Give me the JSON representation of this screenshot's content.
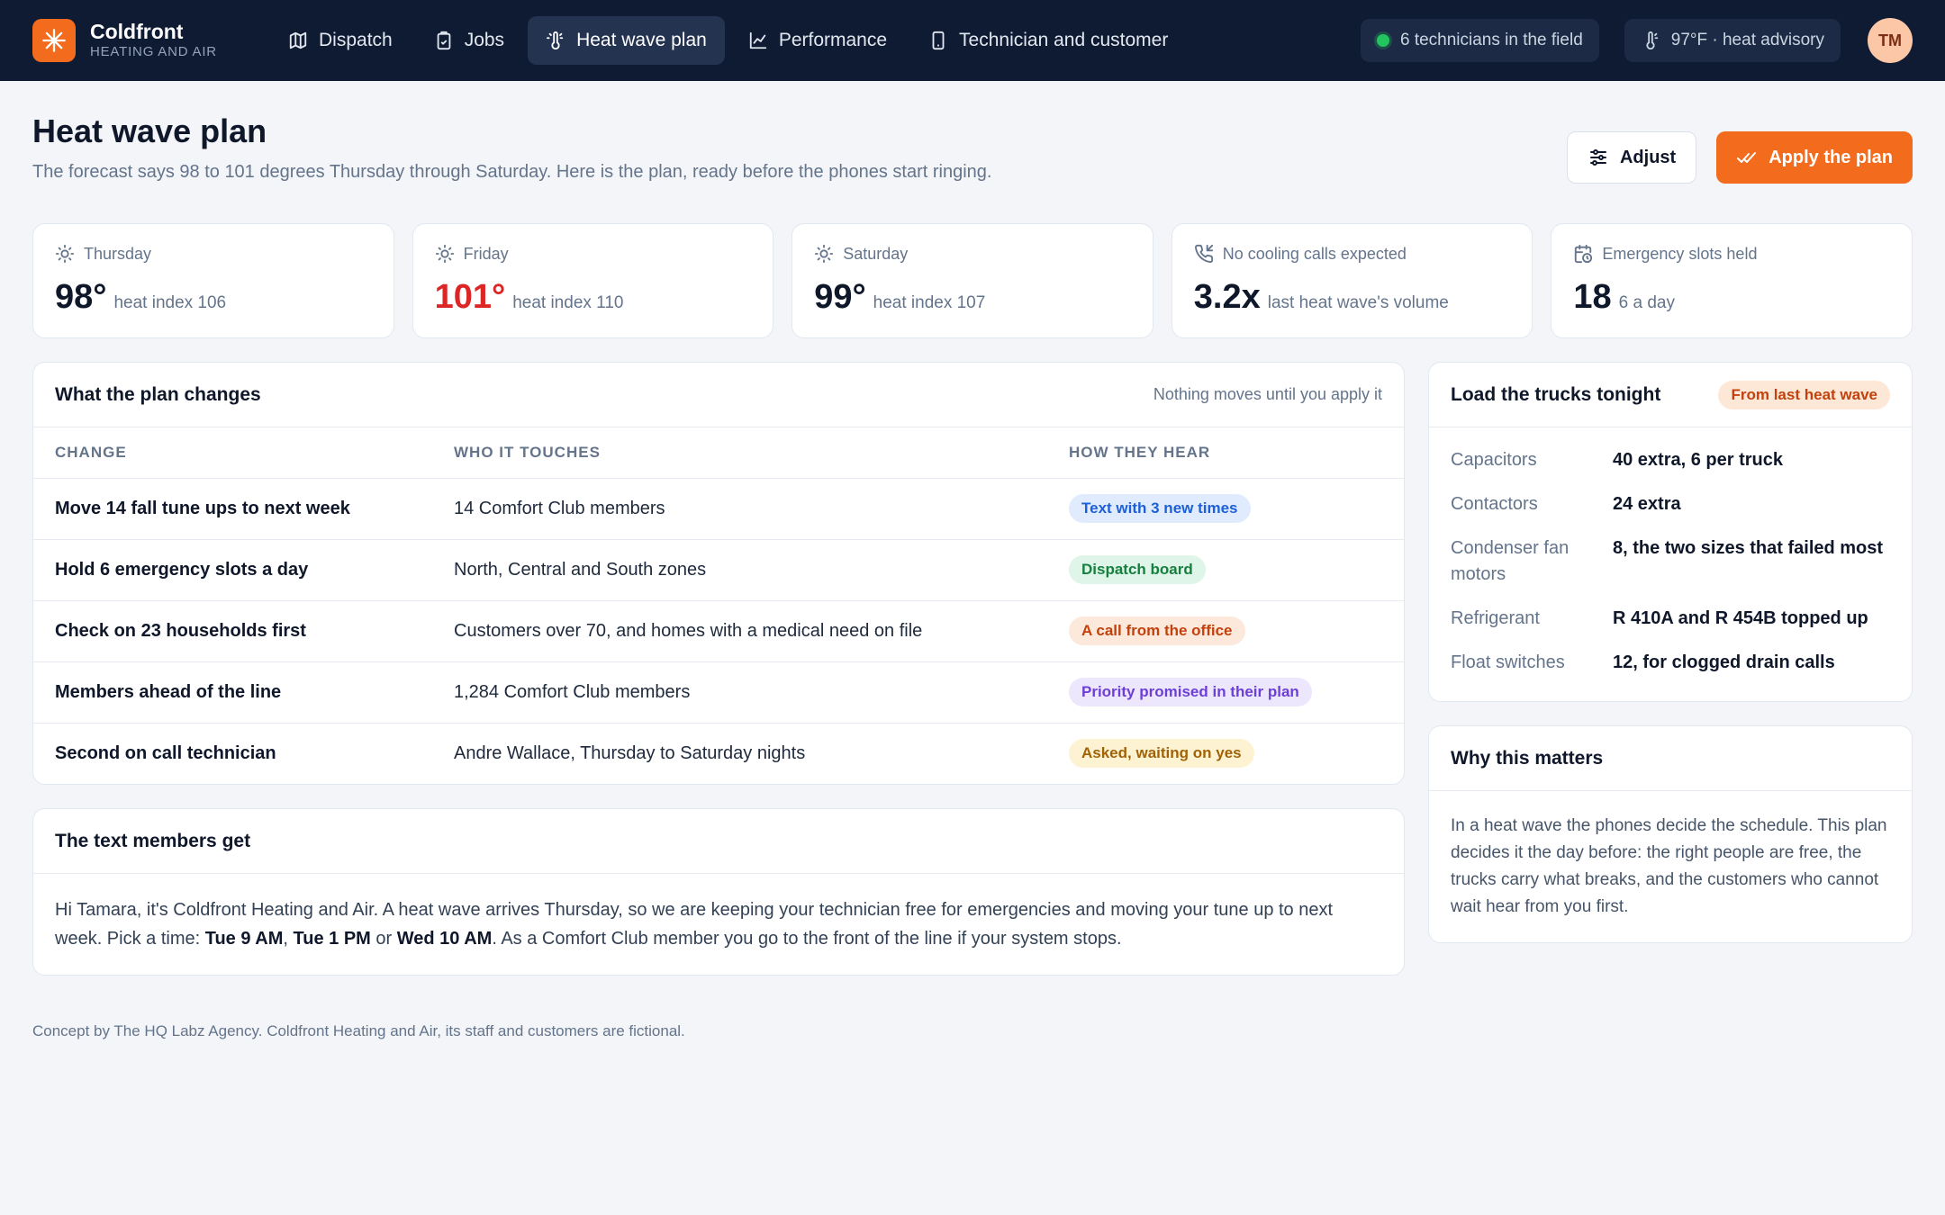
{
  "brand": {
    "name": "Coldfront",
    "sub": "HEATING AND AIR"
  },
  "nav": [
    {
      "label": "Dispatch",
      "icon": "map-icon"
    },
    {
      "label": "Jobs",
      "icon": "clipboard-icon"
    },
    {
      "label": "Heat wave plan",
      "icon": "thermometer-sun-icon",
      "active": true
    },
    {
      "label": "Performance",
      "icon": "chart-line-icon"
    },
    {
      "label": "Technician and customer",
      "icon": "phone-icon"
    }
  ],
  "status": {
    "field": "6 technicians in the field",
    "weather": "97°F · heat advisory",
    "avatar": "TM"
  },
  "page": {
    "title": "Heat wave plan",
    "subtitle": "The forecast says 98 to 101 degrees Thursday through Saturday. Here is the plan, ready before the phones start ringing.",
    "adjust": "Adjust",
    "apply": "Apply the plan"
  },
  "stats": [
    {
      "label": "Thursday",
      "value": "98°",
      "sub": "heat index 106"
    },
    {
      "label": "Friday",
      "value": "101°",
      "sub": "heat index 110",
      "hot": true
    },
    {
      "label": "Saturday",
      "value": "99°",
      "sub": "heat index 107"
    },
    {
      "label": "No cooling calls expected",
      "value": "3.2x",
      "sub": "last heat wave's volume"
    },
    {
      "label": "Emergency slots held",
      "value": "18",
      "sub": "6 a day"
    }
  ],
  "changes": {
    "title": "What the plan changes",
    "note": "Nothing moves until you apply it",
    "columns": [
      "CHANGE",
      "WHO IT TOUCHES",
      "HOW THEY HEAR"
    ],
    "rows": [
      {
        "change": "Move 14 fall tune ups to next week",
        "who": "14 Comfort Club members",
        "how": "Text with 3 new times",
        "color": "blue"
      },
      {
        "change": "Hold 6 emergency slots a day",
        "who": "North, Central and South zones",
        "how": "Dispatch board",
        "color": "green"
      },
      {
        "change": "Check on 23 households first",
        "who": "Customers over 70, and homes with a medical need on file",
        "how": "A call from the office",
        "color": "orange"
      },
      {
        "change": "Members ahead of the line",
        "who": "1,284 Comfort Club members",
        "how": "Priority promised in their plan",
        "color": "purple"
      },
      {
        "change": "Second on call technician",
        "who": "Andre Wallace, Thursday to Saturday nights",
        "how": "Asked, waiting on yes",
        "color": "yellow"
      }
    ]
  },
  "message": {
    "title": "The text members get",
    "part1": "Hi Tamara, it's Coldfront Heating and Air. A heat wave arrives Thursday, so we are keeping your technician free for emergencies and moving your tune up to next week. Pick a time: ",
    "t1": "Tue 9 AM",
    "sep1": ", ",
    "t2": "Tue 1 PM",
    "sep2": " or ",
    "t3": "Wed 10 AM",
    "part2": ". As a Comfort Club member you go to the front of the line if your system stops."
  },
  "trucks": {
    "title": "Load the trucks tonight",
    "tag": "From last heat wave",
    "items": [
      {
        "key": "Capacitors",
        "val": "40 extra, 6 per truck"
      },
      {
        "key": "Contactors",
        "val": "24 extra"
      },
      {
        "key": "Condenser fan motors",
        "val": "8, the two sizes that failed most"
      },
      {
        "key": "Refrigerant",
        "val": "R 410A and R 454B topped up"
      },
      {
        "key": "Float switches",
        "val": "12, for clogged drain calls"
      }
    ]
  },
  "why": {
    "title": "Why this matters",
    "body": "In a heat wave the phones decide the schedule. This plan decides it the day before: the right people are free, the trucks carry what breaks, and the customers who cannot wait hear from you first."
  },
  "footer": "Concept by The HQ Labz Agency. Coldfront Heating and Air, its staff and customers are fictional.",
  "colors": {
    "brand": "#f36b1c",
    "nav_bg": "#0f1b33",
    "hot": "#dc2626"
  }
}
